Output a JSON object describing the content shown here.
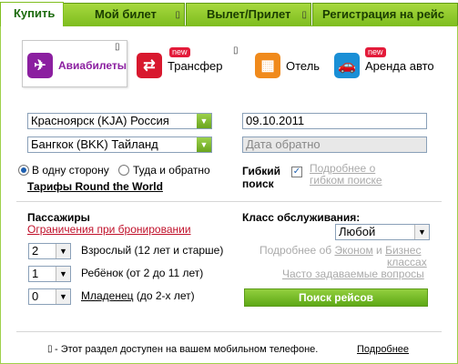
{
  "tabs": [
    {
      "label": "Купить",
      "active": true
    },
    {
      "label": "Мой билет",
      "active": false
    },
    {
      "label": "Вылет/Прилет",
      "active": false
    },
    {
      "label": "Регистрация на рейс",
      "active": false
    }
  ],
  "services": {
    "air": {
      "label": "Авиабилеты",
      "icon": "plane-icon"
    },
    "transfer": {
      "label": "Трансфер",
      "badge": "new",
      "icon": "transfer-icon"
    },
    "hotel": {
      "label": "Отель",
      "icon": "hotel-icon"
    },
    "car": {
      "label": "Аренда авто",
      "badge": "new",
      "icon": "car-icon"
    }
  },
  "route": {
    "from": "Красноярск (KJA) Россия",
    "to": "Бангкок (BKK) Тайланд",
    "date_out": "09.10.2011",
    "date_back_placeholder": "Дата обратно",
    "one_way_label": "В одну сторону",
    "round_trip_label": "Туда и обратно",
    "rtw_link": "Тарифы Round the World"
  },
  "flex": {
    "label_line1": "Гибкий",
    "label_line2": "поиск",
    "more_line1": "Подробнее о",
    "more_line2": "гибком поиске"
  },
  "passengers": {
    "title": "Пассажиры",
    "restrictions_link": "Ограничения при бронировании",
    "rows": [
      {
        "count": "2",
        "label": "Взрослый (12 лет и старше)"
      },
      {
        "count": "1",
        "label": "Ребёнок (от 2 до 11 лет)"
      },
      {
        "count": "0",
        "label": "Младенец",
        "suffix": "(до 2-х лет)"
      }
    ]
  },
  "service_class": {
    "title": "Класс обслуживания:",
    "value": "Любой",
    "more_prefix": "Подробнее об",
    "economy": "Эконом",
    "and": "и",
    "business": "Бизнес",
    "classes": "классах",
    "faq": "Часто задаваемые вопросы"
  },
  "search_button": "Поиск рейсов",
  "footer": {
    "text": "- Этот раздел доступен на вашем мобильном телефоне.",
    "more": "Подробнее"
  },
  "colors": {
    "accent": "#7fbe1f",
    "link": "#c0102a",
    "air_icon": "#8b1fa0",
    "transfer_icon": "#d8182e",
    "hotel_icon": "#f08a1c",
    "car_icon": "#1a8fd6"
  }
}
